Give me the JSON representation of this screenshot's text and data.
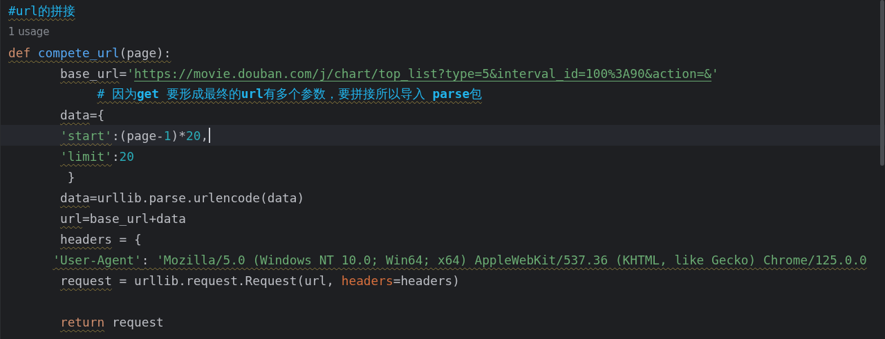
{
  "lines": [
    {
      "kind": "code",
      "tokens": [
        {
          "text": "#url的拼接",
          "kind": "comment",
          "warning": true
        }
      ]
    },
    {
      "kind": "hint",
      "text": "1 usage"
    },
    {
      "kind": "code",
      "tokens": [
        {
          "text": "def ",
          "kind": "keyword",
          "warning": true
        },
        {
          "text": "compete_url",
          "kind": "function",
          "warning": true
        },
        {
          "text": "(page):",
          "kind": "plain",
          "warning": true
        }
      ]
    },
    {
      "kind": "code",
      "tokens": [
        {
          "text": "       base_url",
          "kind": "plain",
          "warning": true
        },
        {
          "text": "=",
          "kind": "plain"
        },
        {
          "text": "'",
          "kind": "string"
        },
        {
          "text": "https://movie.douban.com/j/chart/top_list?type=5&interval_id=100%3A90&action=&",
          "kind": "link"
        },
        {
          "text": "'",
          "kind": "string"
        }
      ]
    },
    {
      "kind": "code",
      "tokens": [
        {
          "text": "            # 因为**get** 要形成最终的**url**有多个参数，要拼接所以导入 **parse**包",
          "kind": "comment",
          "warning": true
        }
      ]
    },
    {
      "kind": "code",
      "tokens": [
        {
          "text": "       data",
          "kind": "plain",
          "warning": true
        },
        {
          "text": "={",
          "kind": "plain"
        }
      ]
    },
    {
      "kind": "code",
      "current": true,
      "tokens": [
        {
          "text": "       'start'",
          "kind": "string",
          "warning": true
        },
        {
          "text": ":(page-",
          "kind": "plain"
        },
        {
          "text": "1",
          "kind": "number"
        },
        {
          "text": ")*",
          "kind": "plain"
        },
        {
          "text": "20",
          "kind": "number"
        },
        {
          "text": ",",
          "kind": "plain"
        }
      ]
    },
    {
      "kind": "code",
      "tokens": [
        {
          "text": "       'limit'",
          "kind": "string",
          "warning": true
        },
        {
          "text": ":",
          "kind": "plain"
        },
        {
          "text": "20",
          "kind": "number"
        }
      ]
    },
    {
      "kind": "code",
      "tokens": [
        {
          "text": "        }",
          "kind": "plain"
        }
      ]
    },
    {
      "kind": "code",
      "tokens": [
        {
          "text": "       data",
          "kind": "plain",
          "warning": true
        },
        {
          "text": "=urllib.parse.urlencode(data)",
          "kind": "plain"
        }
      ]
    },
    {
      "kind": "code",
      "tokens": [
        {
          "text": "       url",
          "kind": "plain",
          "warning": true
        },
        {
          "text": "=base_url+data",
          "kind": "plain"
        }
      ]
    },
    {
      "kind": "code",
      "tokens": [
        {
          "text": "       headers",
          "kind": "plain",
          "warning": true
        },
        {
          "text": " = {",
          "kind": "plain"
        }
      ]
    },
    {
      "kind": "code",
      "tokens": [
        {
          "text": "      'User-Agent'",
          "kind": "string",
          "warning": true
        },
        {
          "text": ": ",
          "kind": "plain",
          "warning": true
        },
        {
          "text": "'Mozilla/5.0 (Windows NT 10.0; Win64; x64) AppleWebKit/537.36 (KHTML, like Gecko) Chrome/125.0.0",
          "kind": "string",
          "warning": true
        }
      ]
    },
    {
      "kind": "code",
      "tokens": [
        {
          "text": "       request",
          "kind": "plain",
          "warning": true
        },
        {
          "text": " = urllib.request.Request(url, ",
          "kind": "plain"
        },
        {
          "text": "headers",
          "kind": "param"
        },
        {
          "text": "=headers)",
          "kind": "plain"
        }
      ]
    },
    {
      "kind": "blank"
    },
    {
      "kind": "code",
      "tokens": [
        {
          "text": "       return",
          "kind": "keyword",
          "warning": true
        },
        {
          "text": " request",
          "kind": "plain"
        }
      ]
    }
  ]
}
